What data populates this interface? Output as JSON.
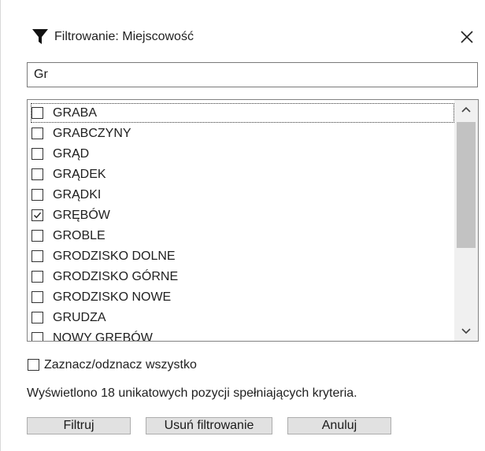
{
  "dialog": {
    "title": "Filtrowanie: Miejscowość",
    "title_icon": "funnel-icon",
    "close_icon": "close-icon"
  },
  "search": {
    "value": "Gr"
  },
  "list": {
    "items": [
      {
        "label": "GRABA",
        "checked": false
      },
      {
        "label": "GRABCZYNY",
        "checked": false
      },
      {
        "label": "GRĄD",
        "checked": false
      },
      {
        "label": "GRĄDEK",
        "checked": false
      },
      {
        "label": "GRĄDKI",
        "checked": false
      },
      {
        "label": "GRĘBÓW",
        "checked": true
      },
      {
        "label": "GROBLE",
        "checked": false
      },
      {
        "label": "GRODZISKO DOLNE",
        "checked": false
      },
      {
        "label": "GRODZISKO GÓRNE",
        "checked": false
      },
      {
        "label": "GRODZISKO NOWE",
        "checked": false
      },
      {
        "label": "GRUDZA",
        "checked": false
      },
      {
        "label": "NOWY GRĘBÓW",
        "checked": false
      }
    ],
    "scroll_icons": [
      "chevron-up-icon",
      "chevron-down-icon"
    ]
  },
  "select_all": {
    "label": "Zaznacz/odznacz wszystko",
    "checked": false
  },
  "status": {
    "text": "Wyświetlono 18 unikatowych pozycji spełniających kryteria."
  },
  "buttons": {
    "filter": "Filtruj",
    "clear": "Usuń filtrowanie",
    "cancel": "Anuluj"
  }
}
